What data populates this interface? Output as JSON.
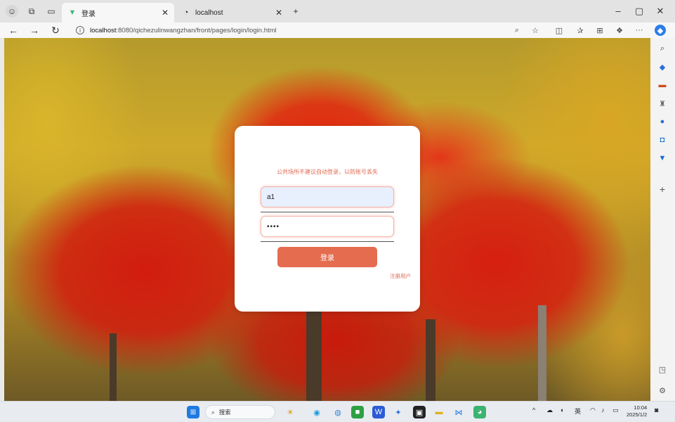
{
  "browser": {
    "tabs": [
      {
        "title": "登录",
        "active": true
      },
      {
        "title": "localhost",
        "active": false
      }
    ],
    "url_host": "localhost",
    "url_rest": ":8080/qichezulinwangzhan/front/pages/login/login.html"
  },
  "login": {
    "notice": "公共场所不建议自动登录，以防账号丢失",
    "username_value": "a1",
    "password_mask": "••••",
    "login_button": "登录",
    "register_link": "注册用户"
  },
  "taskbar": {
    "search_placeholder": "搜索",
    "ime": "英",
    "time": "10:04",
    "date": "2025/1/2"
  },
  "colors": {
    "accent": "#e56c4f",
    "notice_text": "#e0694f"
  },
  "icons": {
    "tab_bar": [
      "profile-icon",
      "workspaces-icon",
      "tab-actions-icon"
    ],
    "tabs": [
      "vue-logo-icon",
      "localhost-page-icon"
    ],
    "toolbar": [
      "read-aloud-icon",
      "favorite-star-icon",
      "split-screen-icon",
      "favorites-icon",
      "collections-icon",
      "extensions-icon",
      "more-icon",
      "copilot-icon"
    ],
    "sidebar": [
      "search-icon",
      "shopping-tag-icon",
      "tools-icon",
      "games-icon",
      "office-icon",
      "outlook-icon",
      "drop-icon",
      "add-icon",
      "sidebar-toggle-icon",
      "settings-icon"
    ],
    "taskbar": [
      "windows-start-icon",
      "widgets-icon",
      "edge-icon",
      "chrome-icon",
      "green-app-icon",
      "word-icon",
      "blue-app-icon",
      "idea-icon",
      "file-explorer-icon",
      "vscode-icon",
      "wechat-icon"
    ]
  }
}
